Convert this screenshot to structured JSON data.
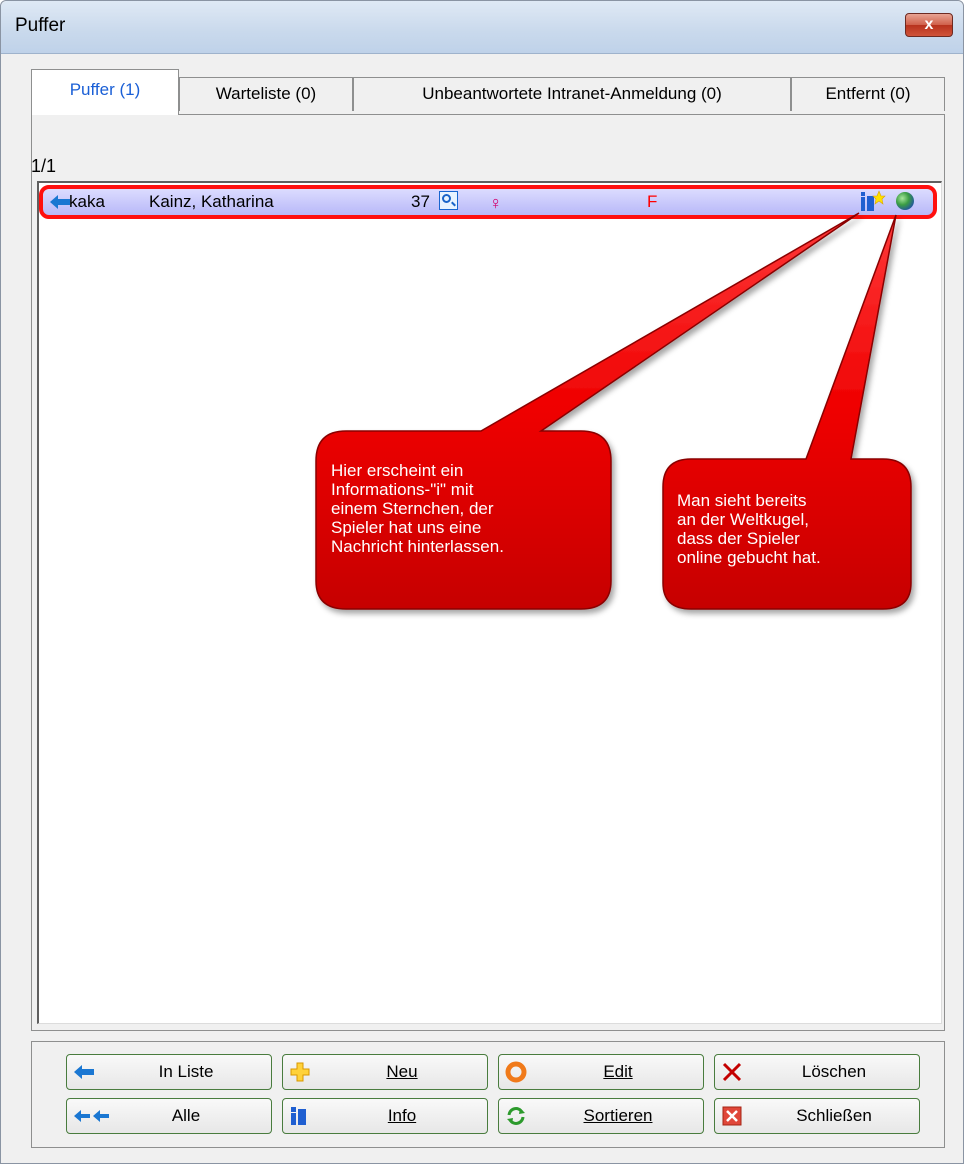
{
  "window": {
    "title": "Puffer",
    "close_label": "x"
  },
  "tabs": [
    {
      "label": "Puffer (1)",
      "active": true
    },
    {
      "label": "Warteliste (0)",
      "active": false
    },
    {
      "label": "Unbeantwortete Intranet-Anmeldung (0)",
      "active": false
    },
    {
      "label": "Entfernt (0)",
      "active": false
    }
  ],
  "list": {
    "counter": "1/1",
    "rows": [
      {
        "code": "kaka",
        "name": "Kainz, Katharina",
        "age": "37",
        "gender_letter": "F"
      }
    ]
  },
  "callouts": {
    "info_note": [
      "Hier erscheint ein",
      "Informations-\"i\" mit",
      "einem Sternchen, der",
      "Spieler hat uns eine",
      "Nachricht hinterlassen."
    ],
    "globe_note": [
      "Man sieht bereits",
      "an der Weltkugel,",
      "dass der Spieler",
      "online gebucht hat."
    ]
  },
  "buttons": {
    "in_liste": "In Liste",
    "neu": "Neu",
    "edit": "Edit",
    "loeschen": "Löschen",
    "alle": "Alle",
    "info": "Info",
    "sortieren": "Sortieren",
    "schliessen": "Schließen"
  },
  "colors": {
    "accent_red": "#ff0000",
    "row_highlight": "#c8c8fa",
    "tab_active_text": "#1a5fd6"
  }
}
